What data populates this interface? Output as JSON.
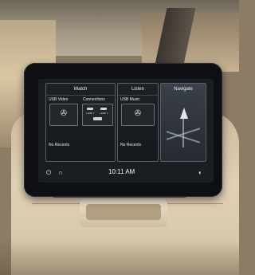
{
  "screen": {
    "clock": "10:11 AM",
    "bottom_bar": {
      "power_icon": "power-icon",
      "headphones_icon": "headphones-icon",
      "settings_icon": "settings-icon"
    }
  },
  "watch": {
    "title": "Watch",
    "usb_video_label": "USB Video",
    "connections_label": "Connections",
    "hdmi1_label": "HDMI 1",
    "hdmi2_label": "HDMI 2",
    "recents": "No Recents"
  },
  "listen": {
    "title": "Listen",
    "usb_music_label": "USB Music",
    "recents": "No Recents"
  },
  "navigate": {
    "title": "Navigate",
    "icon": "navigation-arrow-icon"
  }
}
